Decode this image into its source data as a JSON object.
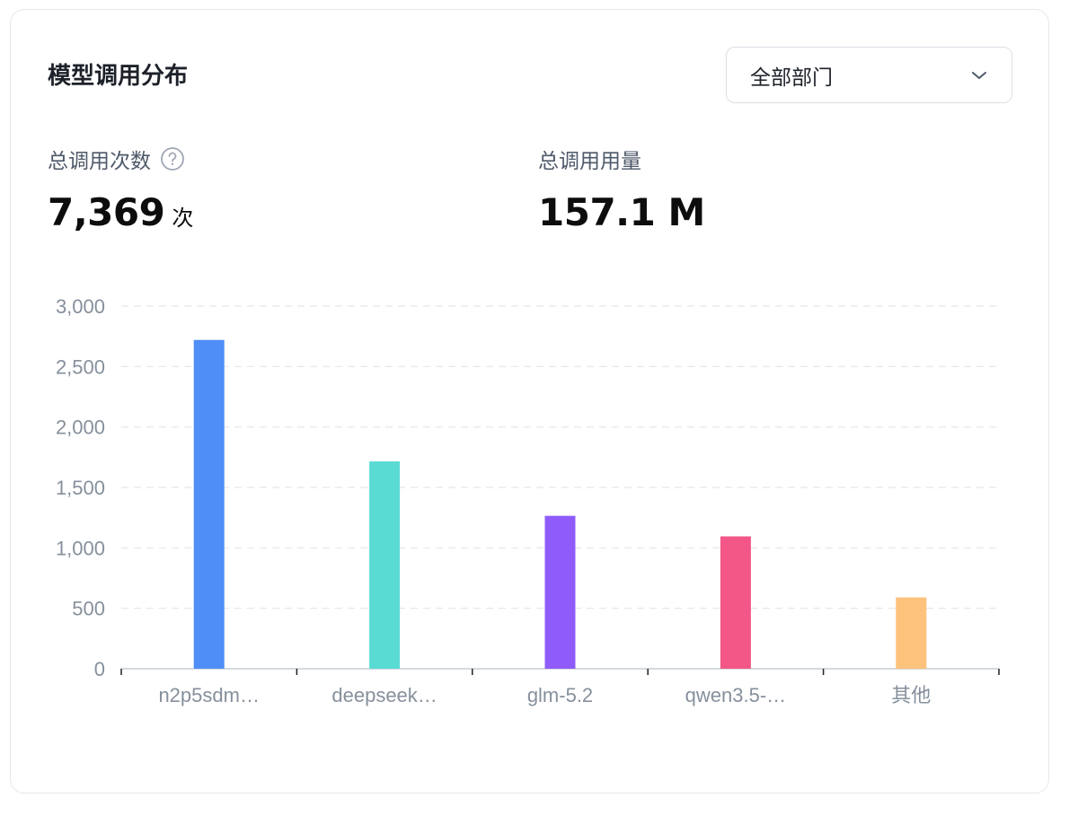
{
  "header": {
    "title": "模型调用分布",
    "department_select": {
      "selected": "全部部门"
    }
  },
  "stats": {
    "total_calls_label": "总调用次数",
    "total_calls_value": "7,369",
    "total_calls_unit": "次",
    "total_usage_label": "总调用用量",
    "total_usage_value": "157.1 M"
  },
  "icons": {
    "help": "question-circle-icon",
    "dropdown": "chevron-down-icon"
  },
  "chart_data": {
    "type": "bar",
    "categories": [
      "n2p5sdm…",
      "deepseek…",
      "glm-5.2",
      "qwen3.5-…",
      "其他"
    ],
    "values": [
      2720,
      1715,
      1265,
      1095,
      590
    ],
    "colors": [
      "#4f8ef7",
      "#59dad3",
      "#8f5cfb",
      "#f25787",
      "#fdc27c"
    ],
    "y_ticks": [
      "0",
      "500",
      "1,000",
      "1,500",
      "2,000",
      "2,500",
      "3,000"
    ],
    "ylim": [
      0,
      3000
    ],
    "grid": true,
    "legend": "none"
  }
}
